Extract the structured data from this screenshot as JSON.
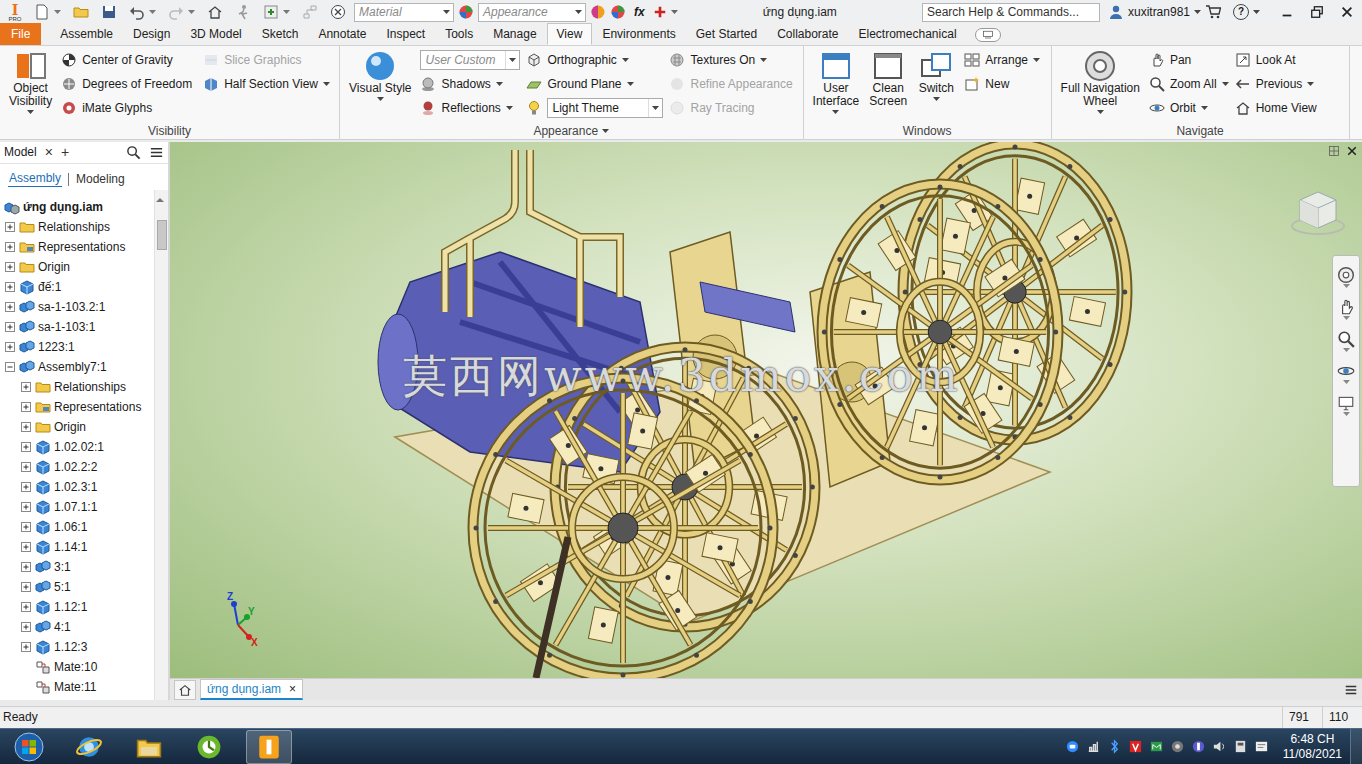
{
  "app": {
    "logo": "I",
    "edition": "PRO"
  },
  "toolbar": {
    "material": "Material",
    "appearance": "Appearance",
    "fx": "fx",
    "title": "ứng dụng.iam",
    "search_placeholder": "Search Help & Commands...",
    "user": "xuxitran981",
    "help": "?"
  },
  "ribbon_tabs": [
    {
      "label": "File",
      "kind": "menu",
      "selected": false
    },
    {
      "label": "Assemble",
      "kind": "tab",
      "selected": false
    },
    {
      "label": "Design",
      "kind": "tab",
      "selected": false
    },
    {
      "label": "3D Model",
      "kind": "tab",
      "selected": false
    },
    {
      "label": "Sketch",
      "kind": "tab",
      "selected": false
    },
    {
      "label": "Annotate",
      "kind": "tab",
      "selected": false
    },
    {
      "label": "Inspect",
      "kind": "tab",
      "selected": false
    },
    {
      "label": "Tools",
      "kind": "tab",
      "selected": false
    },
    {
      "label": "Manage",
      "kind": "tab",
      "selected": false
    },
    {
      "label": "View",
      "kind": "tab",
      "selected": true
    },
    {
      "label": "Environments",
      "kind": "tab",
      "selected": false
    },
    {
      "label": "Get Started",
      "kind": "tab",
      "selected": false
    },
    {
      "label": "Collaborate",
      "kind": "tab",
      "selected": false
    },
    {
      "label": "Electromechanical",
      "kind": "tab",
      "selected": false
    }
  ],
  "ribbon_groups": [
    {
      "title": "Visibility",
      "title_dropdown": false,
      "columns": [
        {
          "tools": [
            {
              "label": [
                "Object",
                "Visibility"
              ],
              "kind": "large",
              "dropdown": true,
              "disabled": false
            }
          ]
        },
        {
          "tools": [
            {
              "label": "Center of Gravity",
              "kind": "small",
              "dropdown": false,
              "disabled": false
            },
            {
              "label": "Degrees of Freedom",
              "kind": "small",
              "dropdown": false,
              "disabled": false
            },
            {
              "label": "iMate Glyphs",
              "kind": "small",
              "dropdown": false,
              "disabled": false
            }
          ]
        },
        {
          "tools": [
            {
              "label": "Slice Graphics",
              "kind": "small",
              "dropdown": false,
              "disabled": true
            },
            {
              "label": "Half Section View",
              "kind": "small",
              "dropdown": true,
              "disabled": false
            }
          ]
        }
      ]
    },
    {
      "title": "Appearance",
      "title_dropdown": true,
      "columns": [
        {
          "tools": [
            {
              "label": [
                "Visual Style"
              ],
              "kind": "large",
              "dropdown": true,
              "disabled": false
            }
          ]
        },
        {
          "tools": [
            {
              "label": "User Custom",
              "kind": "combo",
              "placeholder": true,
              "dropdown": true,
              "disabled": false
            },
            {
              "label": "Shadows",
              "kind": "small",
              "dropdown": true,
              "disabled": false
            },
            {
              "label": "Reflections",
              "kind": "small",
              "dropdown": true,
              "disabled": false
            }
          ]
        },
        {
          "tools": [
            {
              "label": "Orthographic",
              "kind": "small",
              "dropdown": true,
              "disabled": false
            },
            {
              "label": "Ground Plane",
              "kind": "small",
              "dropdown": true,
              "disabled": false
            },
            {
              "label": "Light Theme",
              "kind": "combo",
              "placeholder": false,
              "dropdown": true,
              "disabled": false
            }
          ]
        },
        {
          "tools": [
            {
              "label": "Textures On",
              "kind": "small",
              "dropdown": true,
              "disabled": false
            },
            {
              "label": "Refine Appearance",
              "kind": "small",
              "dropdown": false,
              "disabled": true
            },
            {
              "label": "Ray Tracing",
              "kind": "small",
              "dropdown": false,
              "disabled": true
            }
          ]
        }
      ]
    },
    {
      "title": "Windows",
      "title_dropdown": false,
      "columns": [
        {
          "tools": [
            {
              "label": [
                "User",
                "Interface"
              ],
              "kind": "large",
              "dropdown": true,
              "disabled": false
            },
            {
              "label": [
                "Clean",
                "Screen"
              ],
              "kind": "large",
              "dropdown": false,
              "disabled": false
            },
            {
              "label": [
                "Switch"
              ],
              "kind": "large",
              "dropdown": true,
              "disabled": false
            }
          ]
        },
        {
          "tools": [
            {
              "label": "Arrange",
              "kind": "small",
              "dropdown": true,
              "disabled": false
            },
            {
              "label": "New",
              "kind": "small",
              "dropdown": false,
              "disabled": false
            }
          ]
        }
      ]
    },
    {
      "title": "Navigate",
      "title_dropdown": false,
      "columns": [
        {
          "tools": [
            {
              "label": [
                "Full Navigation",
                "Wheel"
              ],
              "kind": "large",
              "dropdown": true,
              "disabled": false
            }
          ]
        },
        {
          "tools": [
            {
              "label": "Pan",
              "kind": "small",
              "dropdown": false,
              "disabled": false
            },
            {
              "label": "Zoom All",
              "kind": "small",
              "dropdown": true,
              "disabled": false
            },
            {
              "label": "Orbit",
              "kind": "small",
              "dropdown": true,
              "disabled": false
            }
          ]
        },
        {
          "tools": [
            {
              "label": "Look At",
              "kind": "small",
              "dropdown": false,
              "disabled": false
            },
            {
              "label": "Previous",
              "kind": "small",
              "dropdown": true,
              "disabled": false
            },
            {
              "label": "Home View",
              "kind": "small",
              "dropdown": false,
              "disabled": false
            }
          ]
        }
      ]
    }
  ],
  "browser": {
    "title": "Model",
    "close": "×",
    "add": "+",
    "subtabs": [
      {
        "label": "Assembly",
        "selected": true
      },
      {
        "label": "Modeling",
        "selected": false
      }
    ],
    "root": {
      "label": "ứng dụng.iam"
    },
    "items": [
      {
        "label": "Relationships",
        "level": 1,
        "kind": "folder",
        "expanded": false
      },
      {
        "label": "Representations",
        "level": 1,
        "kind": "representations",
        "expanded": false
      },
      {
        "label": "Origin",
        "level": 1,
        "kind": "folder",
        "expanded": false
      },
      {
        "label": "đế:1",
        "level": 1,
        "kind": "part",
        "expanded": false
      },
      {
        "label": "sa-1-103.2:1",
        "level": 1,
        "kind": "subassembly",
        "expanded": false
      },
      {
        "label": "sa-1-103:1",
        "level": 1,
        "kind": "subassembly",
        "expanded": false
      },
      {
        "label": "1223:1",
        "level": 1,
        "kind": "subassembly",
        "expanded": false
      },
      {
        "label": "Assembly7:1",
        "level": 1,
        "kind": "subassembly",
        "expanded": true
      },
      {
        "label": "Relationships",
        "level": 2,
        "kind": "folder",
        "expanded": false
      },
      {
        "label": "Representations",
        "level": 2,
        "kind": "representations",
        "expanded": false
      },
      {
        "label": "Origin",
        "level": 2,
        "kind": "folder",
        "expanded": false
      },
      {
        "label": "1.02.02:1",
        "level": 2,
        "kind": "part",
        "expanded": false
      },
      {
        "label": "1.02.2:2",
        "level": 2,
        "kind": "part",
        "expanded": false
      },
      {
        "label": "1.02.3:1",
        "level": 2,
        "kind": "part",
        "expanded": false
      },
      {
        "label": "1.07.1:1",
        "level": 2,
        "kind": "part",
        "expanded": false
      },
      {
        "label": "1.06:1",
        "level": 2,
        "kind": "part",
        "expanded": false
      },
      {
        "label": "1.14:1",
        "level": 2,
        "kind": "part",
        "expanded": false
      },
      {
        "label": "3:1",
        "level": 2,
        "kind": "subassembly",
        "expanded": false
      },
      {
        "label": "5:1",
        "level": 2,
        "kind": "subassembly",
        "expanded": false
      },
      {
        "label": "1.12:1",
        "level": 2,
        "kind": "part",
        "expanded": false
      },
      {
        "label": "4:1",
        "level": 2,
        "kind": "subassembly",
        "expanded": false
      },
      {
        "label": "1.12:3",
        "level": 2,
        "kind": "part",
        "expanded": false
      },
      {
        "label": "Mate:10",
        "level": 2,
        "kind": "mate"
      },
      {
        "label": "Mate:11",
        "level": 2,
        "kind": "mate"
      }
    ]
  },
  "viewport": {
    "watermark": "莫西网www.3dmox.com",
    "axes": [
      {
        "label": "Z",
        "color": "#1f3fd0"
      },
      {
        "label": "Y",
        "color": "#18a030"
      },
      {
        "label": "X",
        "color": "#d42020"
      }
    ]
  },
  "doc_tabs": [
    {
      "label": "ứng dụng.iam",
      "close": "×",
      "selected": true
    }
  ],
  "status_bar": {
    "message": "Ready",
    "cells": [
      "791",
      "110"
    ]
  },
  "taskbar": {
    "time": "6:48 CH",
    "date": "11/08/2021"
  }
}
